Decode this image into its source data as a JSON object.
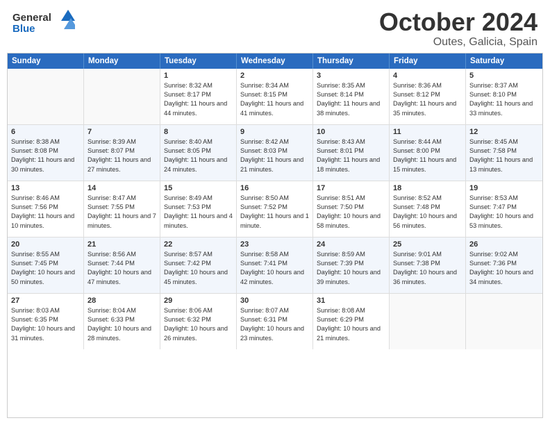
{
  "header": {
    "logo_general": "General",
    "logo_blue": "Blue",
    "title": "October 2024",
    "subtitle": "Outes, Galicia, Spain"
  },
  "days_of_week": [
    "Sunday",
    "Monday",
    "Tuesday",
    "Wednesday",
    "Thursday",
    "Friday",
    "Saturday"
  ],
  "weeks": [
    [
      {
        "day": "",
        "sunrise": "",
        "sunset": "",
        "daylight": "",
        "empty": true
      },
      {
        "day": "",
        "sunrise": "",
        "sunset": "",
        "daylight": "",
        "empty": true
      },
      {
        "day": "1",
        "sunrise": "Sunrise: 8:32 AM",
        "sunset": "Sunset: 8:17 PM",
        "daylight": "Daylight: 11 hours and 44 minutes."
      },
      {
        "day": "2",
        "sunrise": "Sunrise: 8:34 AM",
        "sunset": "Sunset: 8:15 PM",
        "daylight": "Daylight: 11 hours and 41 minutes."
      },
      {
        "day": "3",
        "sunrise": "Sunrise: 8:35 AM",
        "sunset": "Sunset: 8:14 PM",
        "daylight": "Daylight: 11 hours and 38 minutes."
      },
      {
        "day": "4",
        "sunrise": "Sunrise: 8:36 AM",
        "sunset": "Sunset: 8:12 PM",
        "daylight": "Daylight: 11 hours and 35 minutes."
      },
      {
        "day": "5",
        "sunrise": "Sunrise: 8:37 AM",
        "sunset": "Sunset: 8:10 PM",
        "daylight": "Daylight: 11 hours and 33 minutes."
      }
    ],
    [
      {
        "day": "6",
        "sunrise": "Sunrise: 8:38 AM",
        "sunset": "Sunset: 8:08 PM",
        "daylight": "Daylight: 11 hours and 30 minutes."
      },
      {
        "day": "7",
        "sunrise": "Sunrise: 8:39 AM",
        "sunset": "Sunset: 8:07 PM",
        "daylight": "Daylight: 11 hours and 27 minutes."
      },
      {
        "day": "8",
        "sunrise": "Sunrise: 8:40 AM",
        "sunset": "Sunset: 8:05 PM",
        "daylight": "Daylight: 11 hours and 24 minutes."
      },
      {
        "day": "9",
        "sunrise": "Sunrise: 8:42 AM",
        "sunset": "Sunset: 8:03 PM",
        "daylight": "Daylight: 11 hours and 21 minutes."
      },
      {
        "day": "10",
        "sunrise": "Sunrise: 8:43 AM",
        "sunset": "Sunset: 8:01 PM",
        "daylight": "Daylight: 11 hours and 18 minutes."
      },
      {
        "day": "11",
        "sunrise": "Sunrise: 8:44 AM",
        "sunset": "Sunset: 8:00 PM",
        "daylight": "Daylight: 11 hours and 15 minutes."
      },
      {
        "day": "12",
        "sunrise": "Sunrise: 8:45 AM",
        "sunset": "Sunset: 7:58 PM",
        "daylight": "Daylight: 11 hours and 13 minutes."
      }
    ],
    [
      {
        "day": "13",
        "sunrise": "Sunrise: 8:46 AM",
        "sunset": "Sunset: 7:56 PM",
        "daylight": "Daylight: 11 hours and 10 minutes."
      },
      {
        "day": "14",
        "sunrise": "Sunrise: 8:47 AM",
        "sunset": "Sunset: 7:55 PM",
        "daylight": "Daylight: 11 hours and 7 minutes."
      },
      {
        "day": "15",
        "sunrise": "Sunrise: 8:49 AM",
        "sunset": "Sunset: 7:53 PM",
        "daylight": "Daylight: 11 hours and 4 minutes."
      },
      {
        "day": "16",
        "sunrise": "Sunrise: 8:50 AM",
        "sunset": "Sunset: 7:52 PM",
        "daylight": "Daylight: 11 hours and 1 minute."
      },
      {
        "day": "17",
        "sunrise": "Sunrise: 8:51 AM",
        "sunset": "Sunset: 7:50 PM",
        "daylight": "Daylight: 10 hours and 58 minutes."
      },
      {
        "day": "18",
        "sunrise": "Sunrise: 8:52 AM",
        "sunset": "Sunset: 7:48 PM",
        "daylight": "Daylight: 10 hours and 56 minutes."
      },
      {
        "day": "19",
        "sunrise": "Sunrise: 8:53 AM",
        "sunset": "Sunset: 7:47 PM",
        "daylight": "Daylight: 10 hours and 53 minutes."
      }
    ],
    [
      {
        "day": "20",
        "sunrise": "Sunrise: 8:55 AM",
        "sunset": "Sunset: 7:45 PM",
        "daylight": "Daylight: 10 hours and 50 minutes."
      },
      {
        "day": "21",
        "sunrise": "Sunrise: 8:56 AM",
        "sunset": "Sunset: 7:44 PM",
        "daylight": "Daylight: 10 hours and 47 minutes."
      },
      {
        "day": "22",
        "sunrise": "Sunrise: 8:57 AM",
        "sunset": "Sunset: 7:42 PM",
        "daylight": "Daylight: 10 hours and 45 minutes."
      },
      {
        "day": "23",
        "sunrise": "Sunrise: 8:58 AM",
        "sunset": "Sunset: 7:41 PM",
        "daylight": "Daylight: 10 hours and 42 minutes."
      },
      {
        "day": "24",
        "sunrise": "Sunrise: 8:59 AM",
        "sunset": "Sunset: 7:39 PM",
        "daylight": "Daylight: 10 hours and 39 minutes."
      },
      {
        "day": "25",
        "sunrise": "Sunrise: 9:01 AM",
        "sunset": "Sunset: 7:38 PM",
        "daylight": "Daylight: 10 hours and 36 minutes."
      },
      {
        "day": "26",
        "sunrise": "Sunrise: 9:02 AM",
        "sunset": "Sunset: 7:36 PM",
        "daylight": "Daylight: 10 hours and 34 minutes."
      }
    ],
    [
      {
        "day": "27",
        "sunrise": "Sunrise: 8:03 AM",
        "sunset": "Sunset: 6:35 PM",
        "daylight": "Daylight: 10 hours and 31 minutes."
      },
      {
        "day": "28",
        "sunrise": "Sunrise: 8:04 AM",
        "sunset": "Sunset: 6:33 PM",
        "daylight": "Daylight: 10 hours and 28 minutes."
      },
      {
        "day": "29",
        "sunrise": "Sunrise: 8:06 AM",
        "sunset": "Sunset: 6:32 PM",
        "daylight": "Daylight: 10 hours and 26 minutes."
      },
      {
        "day": "30",
        "sunrise": "Sunrise: 8:07 AM",
        "sunset": "Sunset: 6:31 PM",
        "daylight": "Daylight: 10 hours and 23 minutes."
      },
      {
        "day": "31",
        "sunrise": "Sunrise: 8:08 AM",
        "sunset": "Sunset: 6:29 PM",
        "daylight": "Daylight: 10 hours and 21 minutes."
      },
      {
        "day": "",
        "sunrise": "",
        "sunset": "",
        "daylight": "",
        "empty": true
      },
      {
        "day": "",
        "sunrise": "",
        "sunset": "",
        "daylight": "",
        "empty": true
      }
    ]
  ]
}
